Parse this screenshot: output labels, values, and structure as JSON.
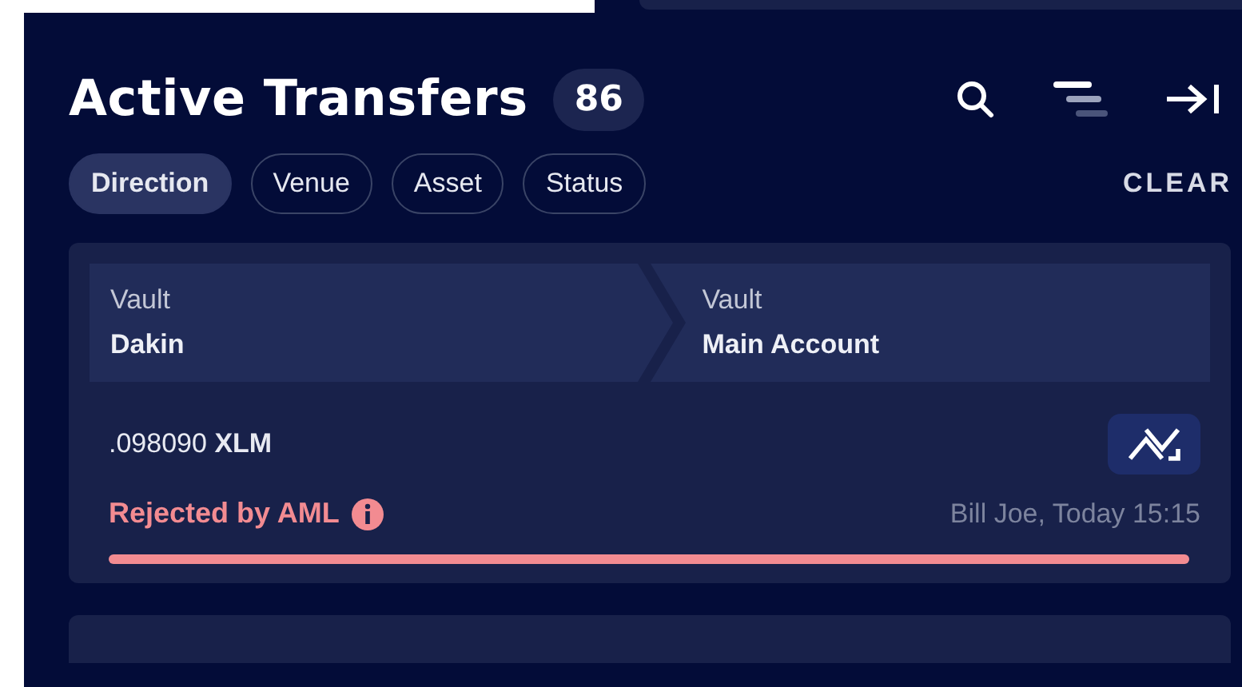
{
  "header": {
    "title": "Active Transfers",
    "count": "86"
  },
  "filters": [
    {
      "label": "Direction",
      "selected": true
    },
    {
      "label": "Venue",
      "selected": false
    },
    {
      "label": "Asset",
      "selected": false
    },
    {
      "label": "Status",
      "selected": false
    }
  ],
  "clear_label": "CLEAR",
  "transfers": [
    {
      "from": {
        "type": "Vault",
        "name": "Dakin"
      },
      "to": {
        "type": "Vault",
        "name": "Main Account"
      },
      "amount": ".098090",
      "asset": "XLM",
      "status": "Rejected by AML",
      "color": "#f28b91",
      "meta": "Bill Joe, Today 15:15",
      "level": 1
    }
  ]
}
